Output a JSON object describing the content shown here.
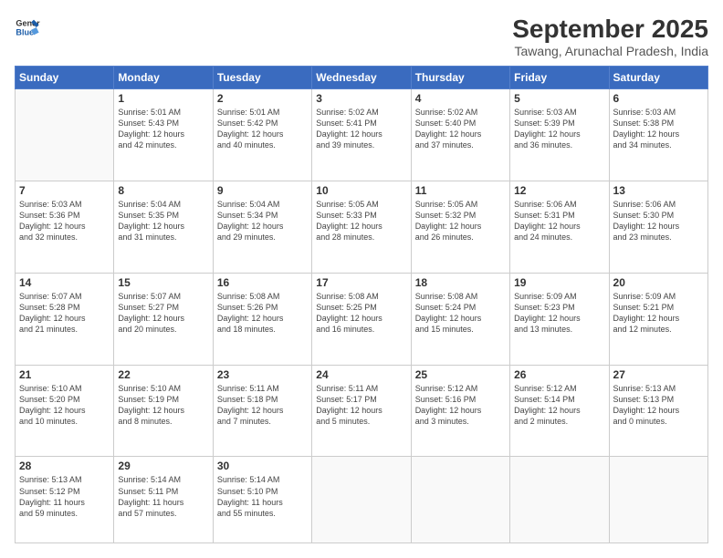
{
  "logo": {
    "line1": "General",
    "line2": "Blue"
  },
  "header": {
    "title": "September 2025",
    "subtitle": "Tawang, Arunachal Pradesh, India"
  },
  "weekdays": [
    "Sunday",
    "Monday",
    "Tuesday",
    "Wednesday",
    "Thursday",
    "Friday",
    "Saturday"
  ],
  "weeks": [
    [
      {
        "day": "",
        "info": ""
      },
      {
        "day": "1",
        "info": "Sunrise: 5:01 AM\nSunset: 5:43 PM\nDaylight: 12 hours\nand 42 minutes."
      },
      {
        "day": "2",
        "info": "Sunrise: 5:01 AM\nSunset: 5:42 PM\nDaylight: 12 hours\nand 40 minutes."
      },
      {
        "day": "3",
        "info": "Sunrise: 5:02 AM\nSunset: 5:41 PM\nDaylight: 12 hours\nand 39 minutes."
      },
      {
        "day": "4",
        "info": "Sunrise: 5:02 AM\nSunset: 5:40 PM\nDaylight: 12 hours\nand 37 minutes."
      },
      {
        "day": "5",
        "info": "Sunrise: 5:03 AM\nSunset: 5:39 PM\nDaylight: 12 hours\nand 36 minutes."
      },
      {
        "day": "6",
        "info": "Sunrise: 5:03 AM\nSunset: 5:38 PM\nDaylight: 12 hours\nand 34 minutes."
      }
    ],
    [
      {
        "day": "7",
        "info": "Sunrise: 5:03 AM\nSunset: 5:36 PM\nDaylight: 12 hours\nand 32 minutes."
      },
      {
        "day": "8",
        "info": "Sunrise: 5:04 AM\nSunset: 5:35 PM\nDaylight: 12 hours\nand 31 minutes."
      },
      {
        "day": "9",
        "info": "Sunrise: 5:04 AM\nSunset: 5:34 PM\nDaylight: 12 hours\nand 29 minutes."
      },
      {
        "day": "10",
        "info": "Sunrise: 5:05 AM\nSunset: 5:33 PM\nDaylight: 12 hours\nand 28 minutes."
      },
      {
        "day": "11",
        "info": "Sunrise: 5:05 AM\nSunset: 5:32 PM\nDaylight: 12 hours\nand 26 minutes."
      },
      {
        "day": "12",
        "info": "Sunrise: 5:06 AM\nSunset: 5:31 PM\nDaylight: 12 hours\nand 24 minutes."
      },
      {
        "day": "13",
        "info": "Sunrise: 5:06 AM\nSunset: 5:30 PM\nDaylight: 12 hours\nand 23 minutes."
      }
    ],
    [
      {
        "day": "14",
        "info": "Sunrise: 5:07 AM\nSunset: 5:28 PM\nDaylight: 12 hours\nand 21 minutes."
      },
      {
        "day": "15",
        "info": "Sunrise: 5:07 AM\nSunset: 5:27 PM\nDaylight: 12 hours\nand 20 minutes."
      },
      {
        "day": "16",
        "info": "Sunrise: 5:08 AM\nSunset: 5:26 PM\nDaylight: 12 hours\nand 18 minutes."
      },
      {
        "day": "17",
        "info": "Sunrise: 5:08 AM\nSunset: 5:25 PM\nDaylight: 12 hours\nand 16 minutes."
      },
      {
        "day": "18",
        "info": "Sunrise: 5:08 AM\nSunset: 5:24 PM\nDaylight: 12 hours\nand 15 minutes."
      },
      {
        "day": "19",
        "info": "Sunrise: 5:09 AM\nSunset: 5:23 PM\nDaylight: 12 hours\nand 13 minutes."
      },
      {
        "day": "20",
        "info": "Sunrise: 5:09 AM\nSunset: 5:21 PM\nDaylight: 12 hours\nand 12 minutes."
      }
    ],
    [
      {
        "day": "21",
        "info": "Sunrise: 5:10 AM\nSunset: 5:20 PM\nDaylight: 12 hours\nand 10 minutes."
      },
      {
        "day": "22",
        "info": "Sunrise: 5:10 AM\nSunset: 5:19 PM\nDaylight: 12 hours\nand 8 minutes."
      },
      {
        "day": "23",
        "info": "Sunrise: 5:11 AM\nSunset: 5:18 PM\nDaylight: 12 hours\nand 7 minutes."
      },
      {
        "day": "24",
        "info": "Sunrise: 5:11 AM\nSunset: 5:17 PM\nDaylight: 12 hours\nand 5 minutes."
      },
      {
        "day": "25",
        "info": "Sunrise: 5:12 AM\nSunset: 5:16 PM\nDaylight: 12 hours\nand 3 minutes."
      },
      {
        "day": "26",
        "info": "Sunrise: 5:12 AM\nSunset: 5:14 PM\nDaylight: 12 hours\nand 2 minutes."
      },
      {
        "day": "27",
        "info": "Sunrise: 5:13 AM\nSunset: 5:13 PM\nDaylight: 12 hours\nand 0 minutes."
      }
    ],
    [
      {
        "day": "28",
        "info": "Sunrise: 5:13 AM\nSunset: 5:12 PM\nDaylight: 11 hours\nand 59 minutes."
      },
      {
        "day": "29",
        "info": "Sunrise: 5:14 AM\nSunset: 5:11 PM\nDaylight: 11 hours\nand 57 minutes."
      },
      {
        "day": "30",
        "info": "Sunrise: 5:14 AM\nSunset: 5:10 PM\nDaylight: 11 hours\nand 55 minutes."
      },
      {
        "day": "",
        "info": ""
      },
      {
        "day": "",
        "info": ""
      },
      {
        "day": "",
        "info": ""
      },
      {
        "day": "",
        "info": ""
      }
    ]
  ]
}
